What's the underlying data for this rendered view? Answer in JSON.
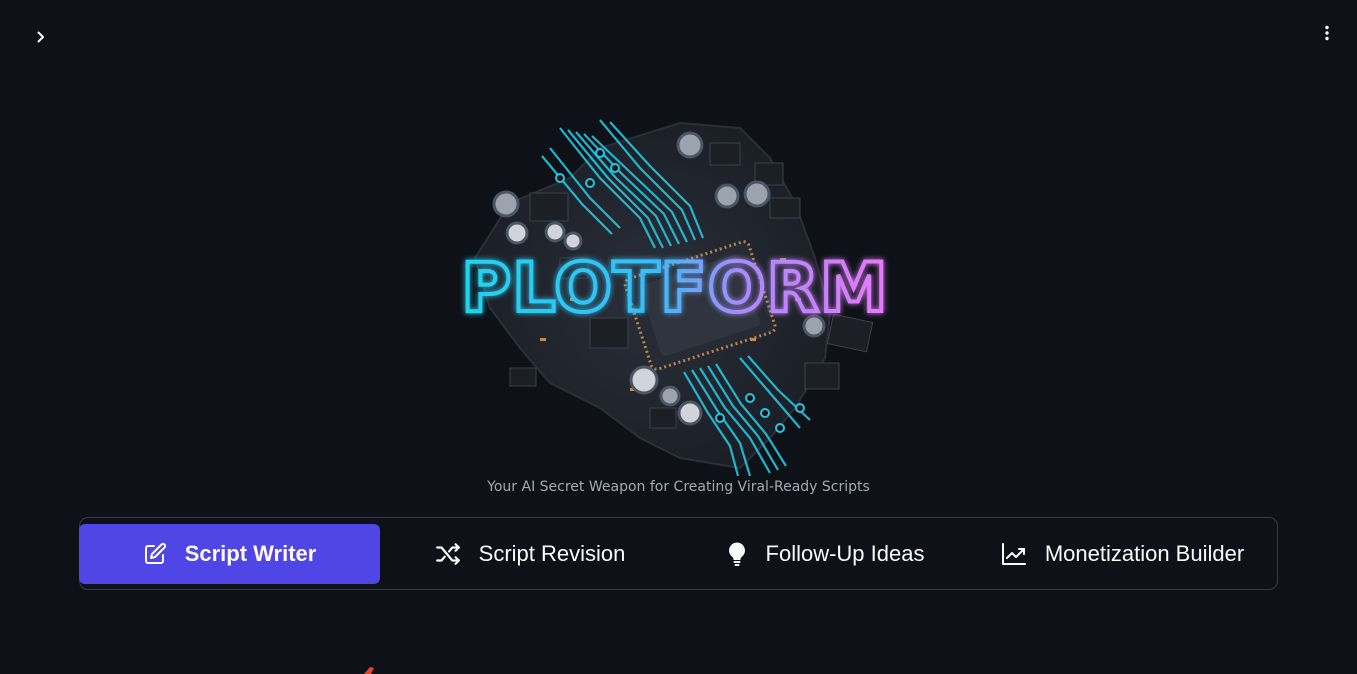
{
  "header": {
    "sidebar_toggle_icon": "chevron-right-icon",
    "menu_icon": "vertical-dots-icon"
  },
  "hero": {
    "logo_text": "PLOTFORM",
    "tagline": "Your AI Secret Weapon for Creating Viral-Ready Scripts"
  },
  "nav": {
    "items": [
      {
        "label": "Script Writer",
        "icon": "edit-icon",
        "active": true
      },
      {
        "label": "Script Revision",
        "icon": "shuffle-icon",
        "active": false
      },
      {
        "label": "Follow-Up Ideas",
        "icon": "lightbulb-icon",
        "active": false
      },
      {
        "label": "Monetization Builder",
        "icon": "trending-up-icon",
        "active": false
      }
    ]
  },
  "colors": {
    "background": "#0e1117",
    "accent": "#4f46e5",
    "border": "#353a44",
    "muted_text": "#a3a8b4",
    "logo_cyan": "#22d3ee",
    "logo_magenta": "#e879f9"
  }
}
